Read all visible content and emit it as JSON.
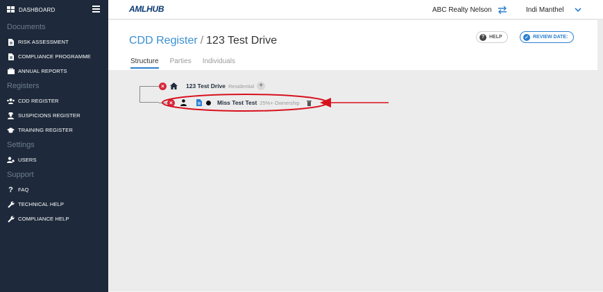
{
  "sidebar": {
    "dashboard_label": "DASHBOARD",
    "sections": [
      {
        "title": "Documents",
        "items": [
          {
            "label": "RISK ASSESSMENT",
            "icon": "document-icon"
          },
          {
            "label": "COMPLIANCE PROGRAMME",
            "icon": "document-icon"
          },
          {
            "label": "ANNUAL REPORTS",
            "icon": "briefcase-icon"
          }
        ]
      },
      {
        "title": "Registers",
        "items": [
          {
            "label": "CDD REGISTER",
            "icon": "users-icon"
          },
          {
            "label": "SUSPICIONS REGISTER",
            "icon": "user-secret-icon"
          },
          {
            "label": "TRAINING REGISTER",
            "icon": "graduation-cap-icon"
          }
        ]
      },
      {
        "title": "Settings",
        "items": [
          {
            "label": "USERS",
            "icon": "user-gear-icon"
          }
        ]
      },
      {
        "title": "Support",
        "items": [
          {
            "label": "FAQ",
            "icon": "question-icon"
          },
          {
            "label": "TECHNICAL HELP",
            "icon": "wrench-icon"
          },
          {
            "label": "COMPLIANCE HELP",
            "icon": "wrench-icon"
          }
        ]
      }
    ]
  },
  "topbar": {
    "logo_a": "AML",
    "logo_b": "HUB",
    "agency": "ABC Realty Nelson",
    "user": "Indi Manthel"
  },
  "header": {
    "breadcrumb_root": "CDD Register",
    "breadcrumb_sep": "/",
    "breadcrumb_current": "123 Test Drive",
    "help_label": "HELP",
    "review_label": "REVIEW DATE:",
    "tabs": [
      "Structure",
      "Parties",
      "Individuals"
    ]
  },
  "tree": {
    "root": {
      "name": "123 Test Drive",
      "type": "Residential"
    },
    "child": {
      "name": "Miss Test Test",
      "type": "25%+ Ownership"
    }
  },
  "colors": {
    "sidebar_bg": "#1e2a3b",
    "accent": "#2a7fd0",
    "remove": "#d6283b",
    "annotation": "#d8101d"
  }
}
